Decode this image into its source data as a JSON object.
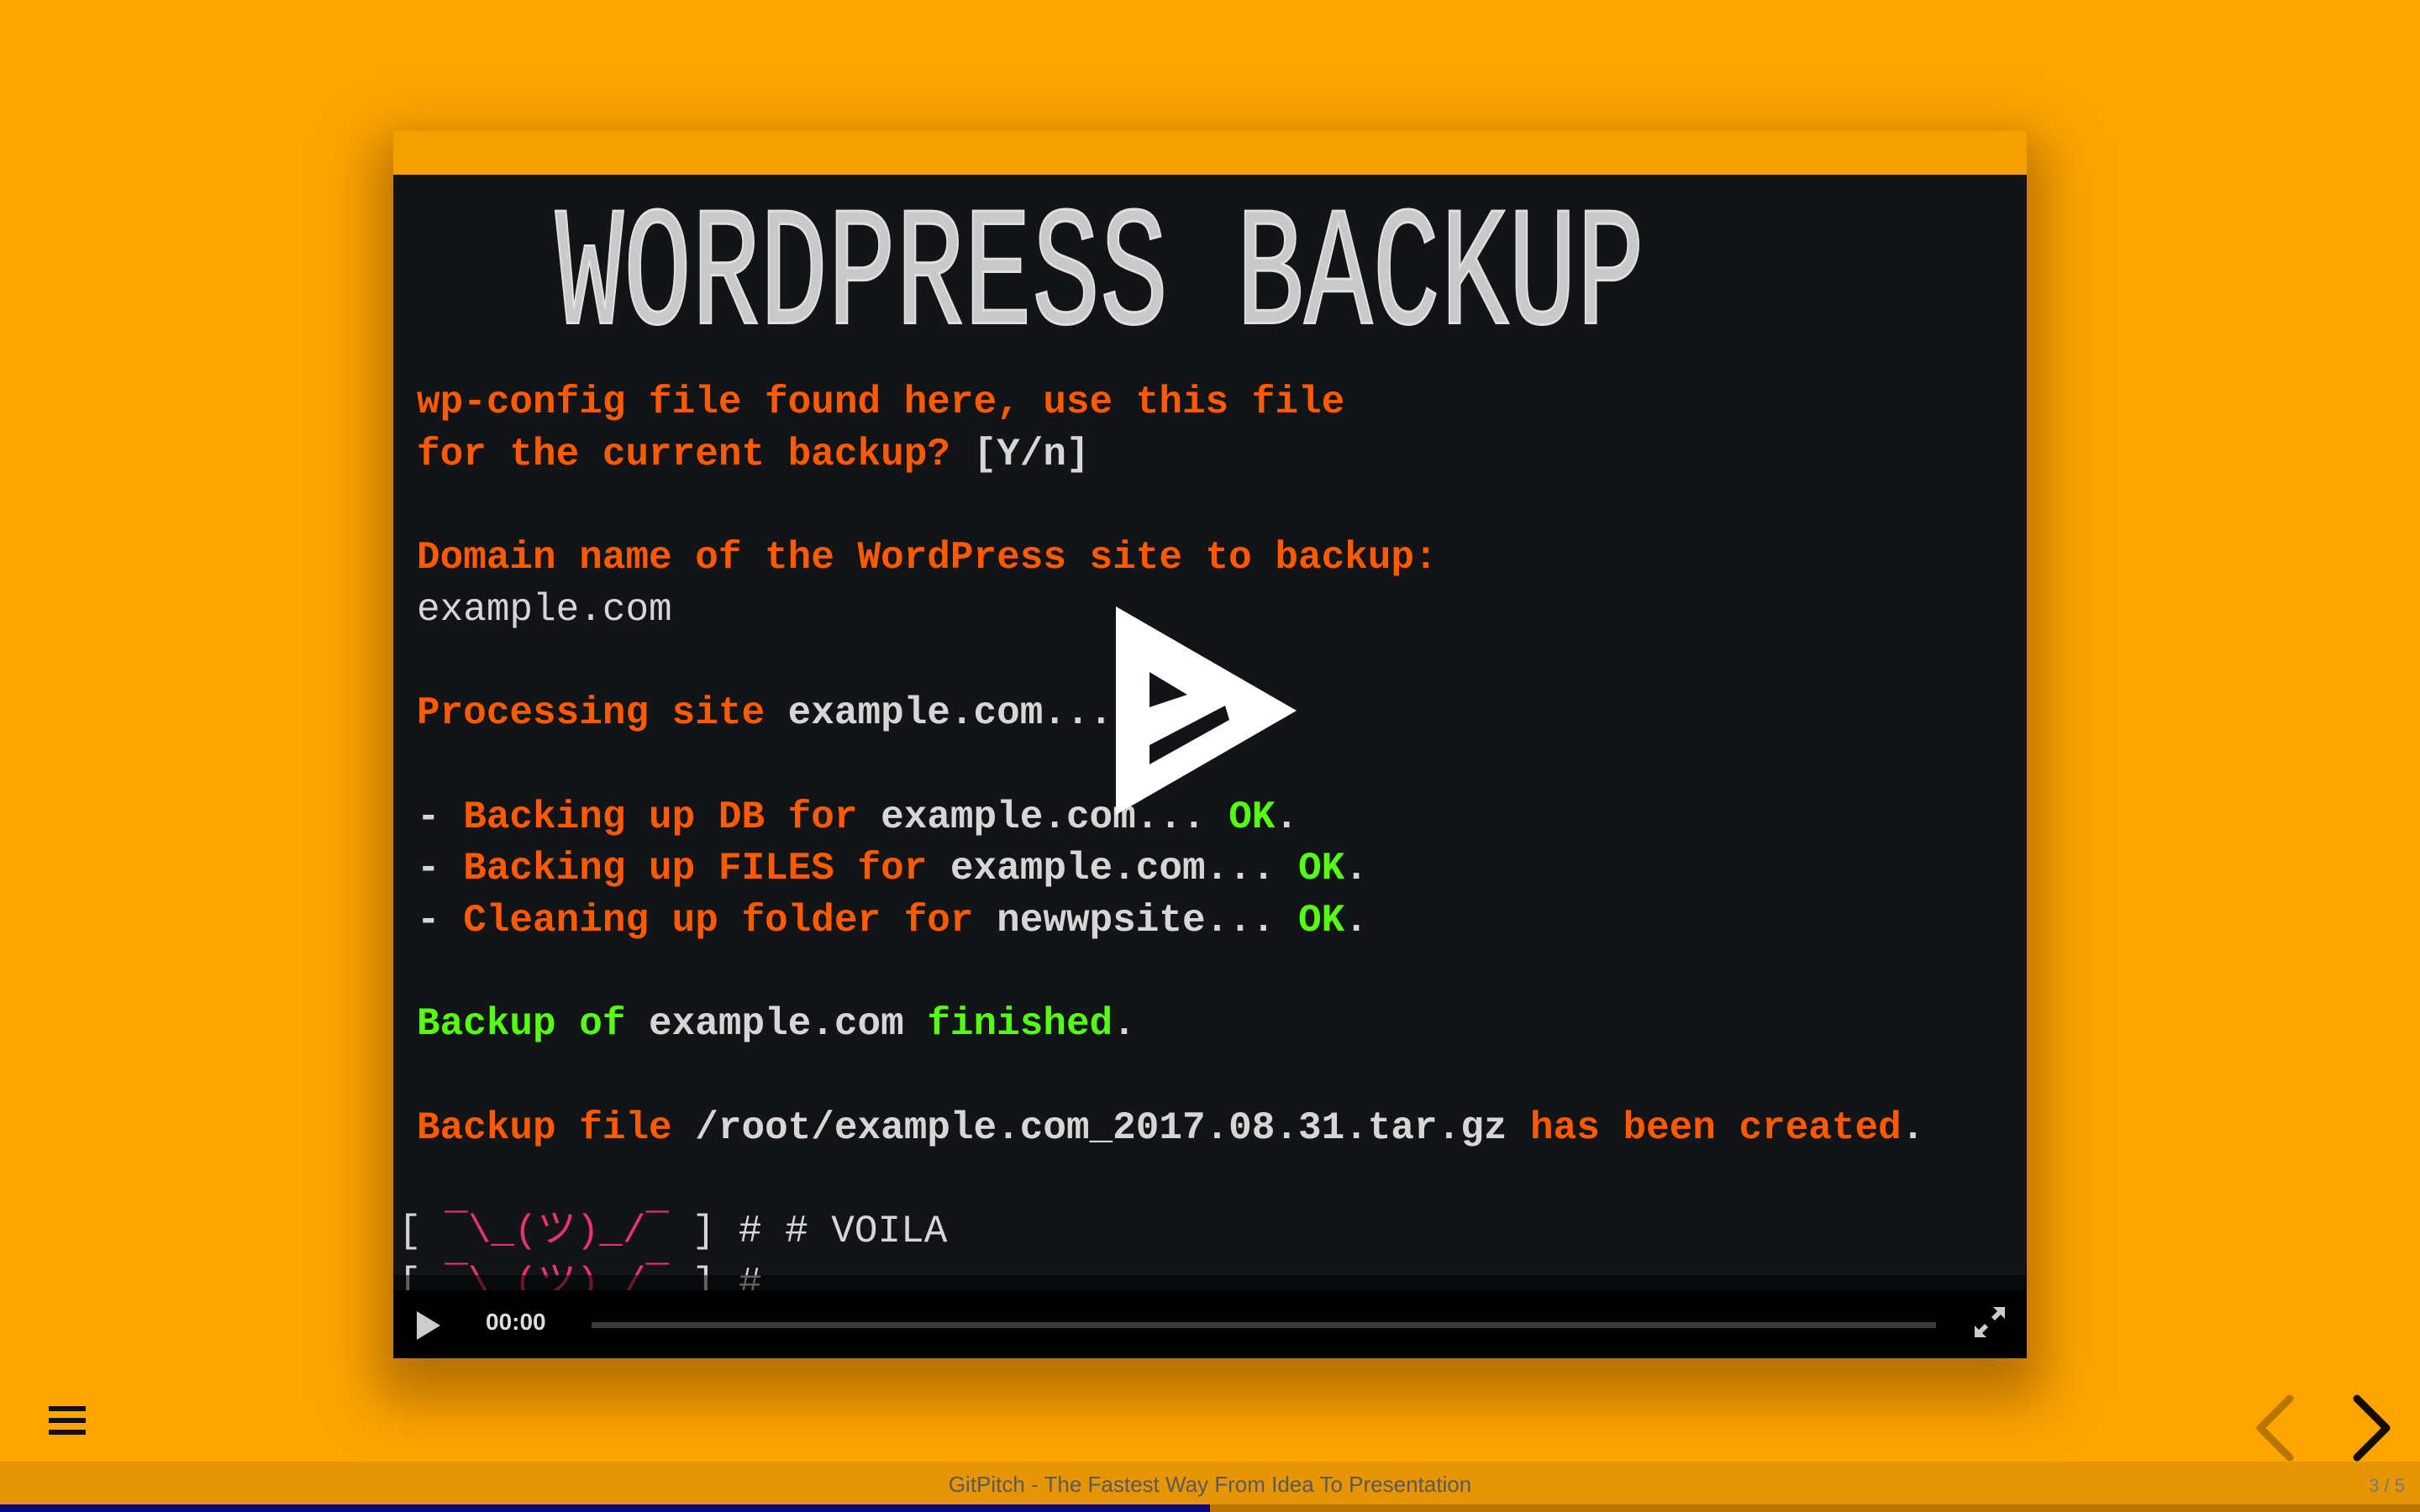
{
  "colors": {
    "background": "#ffa500",
    "prompt_orange": "#ff5a00",
    "ok_green": "#55ff11",
    "shrug_pink": "#e8336b",
    "progress_fill": "#0c0580"
  },
  "terminal": {
    "ascii_title": "WORDPRESS BACKUP",
    "lines": [
      [
        {
          "t": "wp-config file found here, use this file",
          "c": "o"
        }
      ],
      [
        {
          "t": "for the current backup? ",
          "c": "o"
        },
        {
          "t": "[Y/n]",
          "c": "w"
        }
      ],
      [],
      [
        {
          "t": "Domain name of the WordPress site to backup:",
          "c": "o"
        }
      ],
      [
        {
          "t": "example.com",
          "c": "n"
        }
      ],
      [],
      [
        {
          "t": "Processing site ",
          "c": "o"
        },
        {
          "t": "example.com...",
          "c": "w"
        }
      ],
      [],
      [
        {
          "t": "- ",
          "c": "w"
        },
        {
          "t": "Backing up DB for ",
          "c": "o"
        },
        {
          "t": "example.com... ",
          "c": "w"
        },
        {
          "t": "OK",
          "c": "g"
        },
        {
          "t": ".",
          "c": "w"
        }
      ],
      [
        {
          "t": "- ",
          "c": "w"
        },
        {
          "t": "Backing up FILES for ",
          "c": "o"
        },
        {
          "t": "example.com... ",
          "c": "w"
        },
        {
          "t": "OK",
          "c": "g"
        },
        {
          "t": ".",
          "c": "w"
        }
      ],
      [
        {
          "t": "- ",
          "c": "w"
        },
        {
          "t": "Cleaning up folder for ",
          "c": "o"
        },
        {
          "t": "newwpsite... ",
          "c": "w"
        },
        {
          "t": "OK",
          "c": "g"
        },
        {
          "t": ".",
          "c": "w"
        }
      ],
      [],
      [
        {
          "t": "Backup of ",
          "c": "g"
        },
        {
          "t": "example.com ",
          "c": "w"
        },
        {
          "t": "finished",
          "c": "g"
        },
        {
          "t": ".",
          "c": "w"
        }
      ],
      [],
      [
        {
          "t": "Backup file ",
          "c": "o"
        },
        {
          "t": "/root/example.com_2017.08.31.tar.gz ",
          "c": "w"
        },
        {
          "t": "has been created",
          "c": "o"
        },
        {
          "t": ".",
          "c": "w"
        }
      ],
      [],
      [
        {
          "t": "[ ",
          "c": "n",
          "s": 1
        },
        {
          "t": "¯\\_(ツ)_/¯",
          "c": "p"
        },
        {
          "t": " ] # # VOILA",
          "c": "n"
        }
      ],
      [
        {
          "t": "[ ",
          "c": "n",
          "s": 1
        },
        {
          "t": "¯\\_(ツ)_/¯",
          "c": "p"
        },
        {
          "t": " ] #",
          "c": "n"
        }
      ]
    ]
  },
  "player": {
    "time": "00:00",
    "big_play_icon": "asciinema-play-icon",
    "play_icon": "play-icon",
    "fullscreen_icon": "fullscreen-icon"
  },
  "nav": {
    "menu_icon": "hamburger-icon",
    "prev_icon": "chevron-left-icon",
    "next_icon": "chevron-right-icon"
  },
  "footer": {
    "text": "GitPitch - The Fastest Way From Idea To Presentation",
    "slide_number": "3 / 5",
    "progress": 0.5
  }
}
